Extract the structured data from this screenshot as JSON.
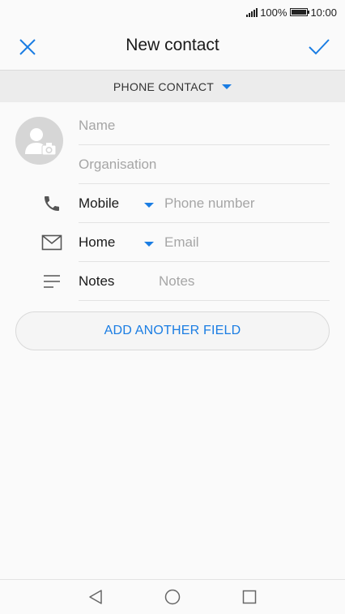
{
  "status_bar": {
    "battery": "100%",
    "time": "10:00"
  },
  "header": {
    "title": "New contact",
    "close_icon": "close-icon",
    "save_icon": "checkmark-icon"
  },
  "account": {
    "label": "PHONE CONTACT"
  },
  "form": {
    "name_placeholder": "Name",
    "organisation_placeholder": "Organisation",
    "phone": {
      "type_label": "Mobile",
      "placeholder": "Phone number"
    },
    "email": {
      "type_label": "Home",
      "placeholder": "Email"
    },
    "notes": {
      "label": "Notes",
      "placeholder": "Notes"
    }
  },
  "add_field": {
    "label": "ADD ANOTHER FIELD"
  },
  "colors": {
    "accent": "#1a7de3",
    "background": "#fafafa",
    "divider": "#e3e3e3"
  }
}
